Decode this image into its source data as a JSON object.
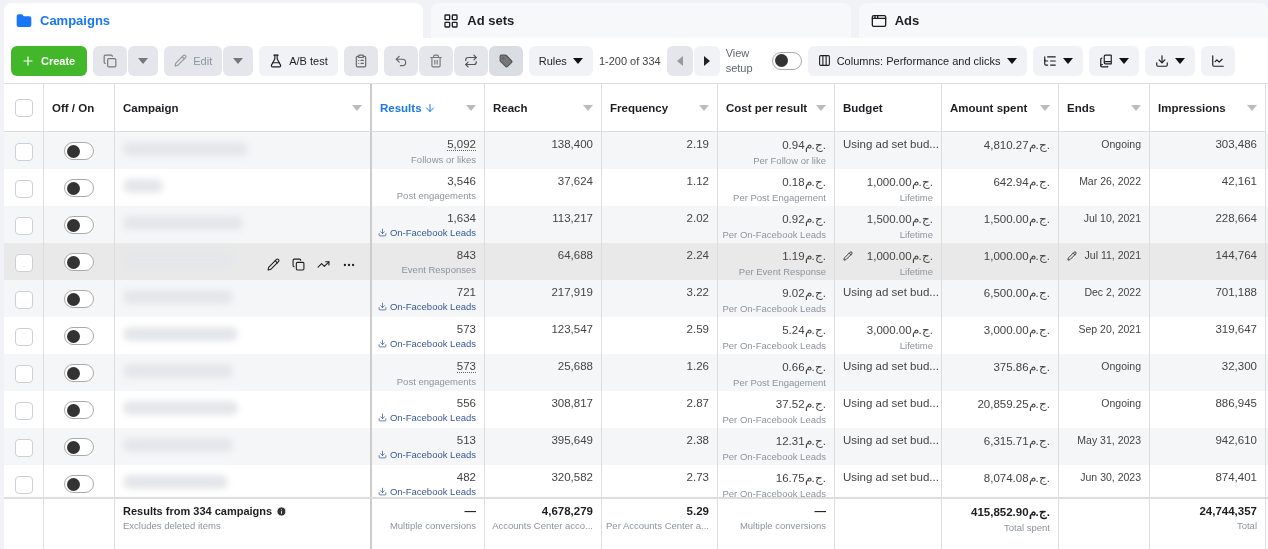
{
  "tabs": [
    {
      "label": "Campaigns",
      "kind": "campaigns",
      "selected": true
    },
    {
      "label": "Ad sets",
      "kind": "adsets",
      "selected": false
    },
    {
      "label": "Ads",
      "kind": "ads",
      "selected": false
    }
  ],
  "toolbar": {
    "create": "Create",
    "edit": {
      "label": "Edit",
      "disabled": true
    },
    "ab_test": "A/B test",
    "rules": "Rules",
    "pagination": "1-200 of 334",
    "view_setup": {
      "label": "View setup",
      "on": false
    },
    "columns": "Columns: Performance and clicks"
  },
  "table": {
    "select_all": {
      "checked": false
    },
    "columns": [
      {
        "label": "Off / On",
        "sorted": false,
        "menu": false
      },
      {
        "label": "Campaign",
        "sorted": false,
        "menu": true
      },
      {
        "label": "Results",
        "sorted": true,
        "menu": true
      },
      {
        "label": "Reach",
        "sorted": false,
        "menu": true
      },
      {
        "label": "Frequency",
        "sorted": false,
        "menu": true
      },
      {
        "label": "Cost per result",
        "sorted": false,
        "menu": true
      },
      {
        "label": "Budget",
        "sorted": false,
        "menu": false
      },
      {
        "label": "Amount spent",
        "sorted": false,
        "menu": true
      },
      {
        "label": "Ends",
        "sorted": false,
        "menu": true
      },
      {
        "label": "Impressions",
        "sorted": false,
        "menu": true
      }
    ],
    "rows": [
      {
        "checked": false,
        "on": false,
        "hovered": false,
        "results": {
          "value": "5,092",
          "underlined": true,
          "kind": "plain",
          "label": "Follows or likes"
        },
        "reach": "138,400",
        "frequency": "2.19",
        "cost": {
          "value": "0.94ج.م.",
          "label": "Per Follow or like"
        },
        "budget": {
          "kind": "adset",
          "value": "Using ad set bud..."
        },
        "amount_spent": "4,810.27ج.م.",
        "ends": "Ongoing",
        "impressions": "303,486"
      },
      {
        "checked": false,
        "on": false,
        "hovered": false,
        "results": {
          "value": "3,546",
          "underlined": false,
          "kind": "plain",
          "label": "Post engagements"
        },
        "reach": "37,624",
        "frequency": "1.12",
        "cost": {
          "value": "0.18ج.م.",
          "label": "Per Post Engagement"
        },
        "budget": {
          "kind": "amount",
          "value": "1,000.00ج.م.",
          "label": "Lifetime"
        },
        "amount_spent": "642.94ج.م.",
        "ends": "Mar 26, 2022",
        "impressions": "42,161"
      },
      {
        "checked": false,
        "on": false,
        "hovered": false,
        "results": {
          "value": "1,634",
          "underlined": false,
          "kind": "lead",
          "label": "On-Facebook Leads"
        },
        "reach": "113,217",
        "frequency": "2.02",
        "cost": {
          "value": "0.92ج.م.",
          "label": "Per On-Facebook Leads"
        },
        "budget": {
          "kind": "amount",
          "value": "1,500.00ج.م.",
          "label": "Lifetime"
        },
        "amount_spent": "1,500.00ج.م.",
        "ends": "Jul 10, 2021",
        "impressions": "228,664"
      },
      {
        "checked": false,
        "on": false,
        "hovered": true,
        "results": {
          "value": "843",
          "underlined": false,
          "kind": "plain",
          "label": "Event Responses"
        },
        "reach": "64,688",
        "frequency": "2.24",
        "cost": {
          "value": "1.19ج.م.",
          "label": "Per Event Response"
        },
        "budget": {
          "kind": "amount",
          "value": "1,000.00ج.م.",
          "label": "Lifetime"
        },
        "amount_spent": "1,000.00ج.م.",
        "ends": "Jul 11, 2021",
        "impressions": "144,764"
      },
      {
        "checked": false,
        "on": false,
        "hovered": false,
        "results": {
          "value": "721",
          "underlined": false,
          "kind": "lead",
          "label": "On-Facebook Leads"
        },
        "reach": "217,919",
        "frequency": "3.22",
        "cost": {
          "value": "9.02ج.م.",
          "label": "Per On-Facebook Leads"
        },
        "budget": {
          "kind": "adset",
          "value": "Using ad set bud..."
        },
        "amount_spent": "6,500.00ج.م.",
        "ends": "Dec 2, 2022",
        "impressions": "701,188"
      },
      {
        "checked": false,
        "on": false,
        "hovered": false,
        "results": {
          "value": "573",
          "underlined": false,
          "kind": "lead",
          "label": "On-Facebook Leads"
        },
        "reach": "123,547",
        "frequency": "2.59",
        "cost": {
          "value": "5.24ج.م.",
          "label": "Per On-Facebook Leads"
        },
        "budget": {
          "kind": "amount",
          "value": "3,000.00ج.م.",
          "label": "Lifetime"
        },
        "amount_spent": "3,000.00ج.م.",
        "ends": "Sep 20, 2021",
        "impressions": "319,647"
      },
      {
        "checked": false,
        "on": false,
        "hovered": false,
        "results": {
          "value": "573",
          "underlined": true,
          "kind": "plain",
          "label": "Post engagements"
        },
        "reach": "25,688",
        "frequency": "1.26",
        "cost": {
          "value": "0.66ج.م.",
          "label": "Per Post Engagement"
        },
        "budget": {
          "kind": "adset",
          "value": "Using ad set bud..."
        },
        "amount_spent": "375.86ج.م.",
        "ends": "Ongoing",
        "impressions": "32,300"
      },
      {
        "checked": false,
        "on": false,
        "hovered": false,
        "results": {
          "value": "556",
          "underlined": false,
          "kind": "lead",
          "label": "On-Facebook Leads"
        },
        "reach": "308,817",
        "frequency": "2.87",
        "cost": {
          "value": "37.52ج.م.",
          "label": "Per On-Facebook Leads"
        },
        "budget": {
          "kind": "adset",
          "value": "Using ad set bud..."
        },
        "amount_spent": "20,859.25ج.م.",
        "ends": "Ongoing",
        "impressions": "886,945"
      },
      {
        "checked": false,
        "on": false,
        "hovered": false,
        "results": {
          "value": "513",
          "underlined": false,
          "kind": "lead",
          "label": "On-Facebook Leads"
        },
        "reach": "395,649",
        "frequency": "2.38",
        "cost": {
          "value": "12.31ج.م.",
          "label": "Per On-Facebook Leads"
        },
        "budget": {
          "kind": "adset",
          "value": "Using ad set bud..."
        },
        "amount_spent": "6,315.71ج.م.",
        "ends": "May 31, 2023",
        "impressions": "942,610"
      },
      {
        "checked": false,
        "on": false,
        "hovered": false,
        "results": {
          "value": "482",
          "underlined": false,
          "kind": "lead",
          "label": "On-Facebook Leads"
        },
        "reach": "320,582",
        "frequency": "2.73",
        "cost": {
          "value": "16.75ج.م.",
          "label": "Per On-Facebook Leads"
        },
        "budget": {
          "kind": "adset",
          "value": "Using ad set bud..."
        },
        "amount_spent": "8,074.08ج.م.",
        "ends": "Jun 30, 2023",
        "impressions": "874,401"
      }
    ],
    "footer": {
      "title": "Results from 334 campaigns",
      "note": "Excludes deleted items",
      "results": {
        "value": "—",
        "label": "Multiple conversions"
      },
      "reach": {
        "value": "4,678,279",
        "label": "Accounts Center acco..."
      },
      "frequency": {
        "value": "5.29",
        "label": "Per Accounts Center a..."
      },
      "cost": {
        "value": "—",
        "label": "Multiple conversions"
      },
      "amount_spent": {
        "value": "415,852.90ج.م.",
        "label": "Total spent"
      },
      "impressions": {
        "value": "24,744,357",
        "label": "Total"
      }
    }
  }
}
